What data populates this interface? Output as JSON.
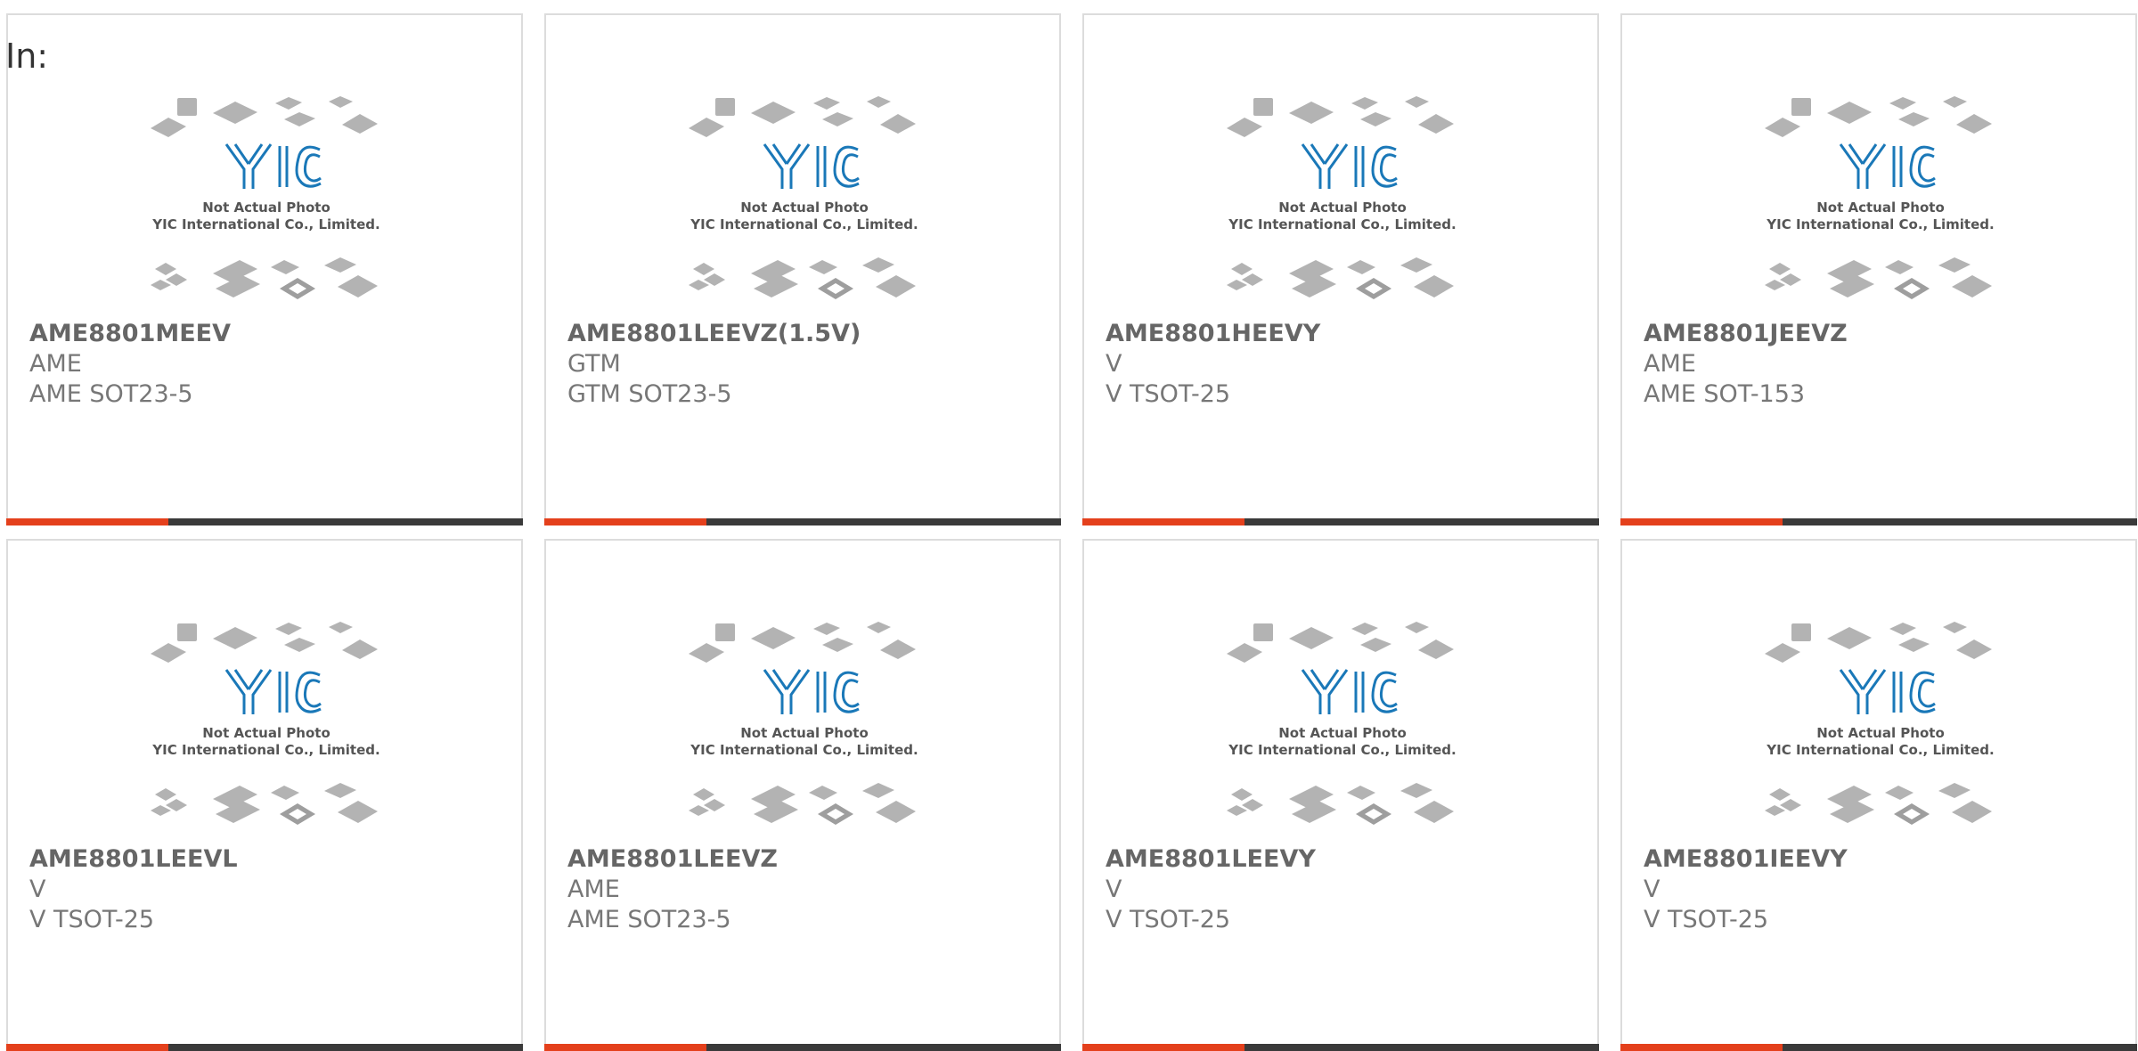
{
  "header": {
    "in_label": "In:"
  },
  "placeholder": {
    "line1": "Not Actual Photo",
    "line2": "YIC International Co., Limited.",
    "logo": "YIC"
  },
  "products": [
    {
      "part": "AME8801MEEV",
      "maker": "AME",
      "package": "AME SOT23-5"
    },
    {
      "part": "AME8801LEEVZ(1.5V)",
      "maker": "GTM",
      "package": "GTM SOT23-5"
    },
    {
      "part": "AME8801HEEVY",
      "maker": "V",
      "package": "V TSOT-25"
    },
    {
      "part": "AME8801JEEVZ",
      "maker": "AME",
      "package": "AME SOT-153"
    },
    {
      "part": "AME8801LEEVL",
      "maker": "V",
      "package": "V TSOT-25"
    },
    {
      "part": "AME8801LEEVZ",
      "maker": "AME",
      "package": "AME SOT23-5"
    },
    {
      "part": "AME8801LEEVY",
      "maker": "V",
      "package": "V TSOT-25"
    },
    {
      "part": "AME8801IEEVY",
      "maker": "V",
      "package": "V TSOT-25"
    }
  ],
  "colors": {
    "accent": "#e4401c",
    "bar": "#3a3a3a",
    "logo": "#1a78b8"
  }
}
